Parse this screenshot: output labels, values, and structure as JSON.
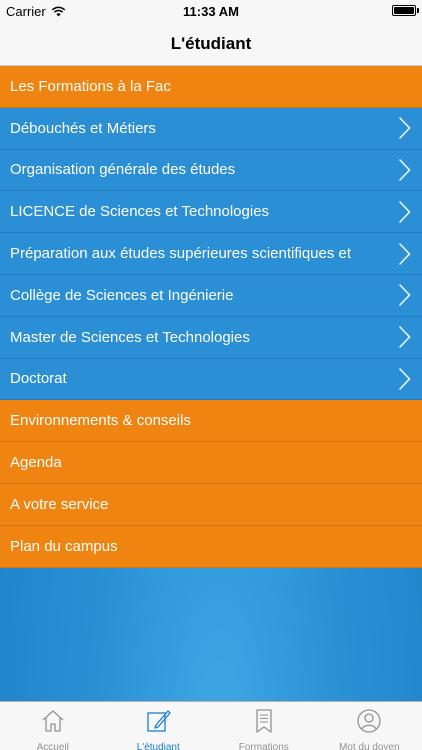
{
  "status_bar": {
    "carrier": "Carrier",
    "time": "11:33 AM"
  },
  "nav": {
    "title": "L'étudiant"
  },
  "menu": [
    {
      "label": "Les Formations à la Fac",
      "kind": "section",
      "chevron": false
    },
    {
      "label": "Débouchés et Métiers",
      "kind": "item",
      "chevron": true
    },
    {
      "label": "Organisation générale des études",
      "kind": "item",
      "chevron": true
    },
    {
      "label": "LICENCE de Sciences et Technologies",
      "kind": "item",
      "chevron": true
    },
    {
      "label": "Préparation aux études supérieures scientifiques et",
      "kind": "item",
      "chevron": true
    },
    {
      "label": "Collège de Sciences et Ingénierie",
      "kind": "item",
      "chevron": true
    },
    {
      "label": "Master de Sciences et Technologies",
      "kind": "item",
      "chevron": true
    },
    {
      "label": "Doctorat",
      "kind": "item",
      "chevron": true
    },
    {
      "label": "Environnements & conseils",
      "kind": "section",
      "chevron": false
    },
    {
      "label": "Agenda",
      "kind": "section",
      "chevron": false
    },
    {
      "label": "A votre service",
      "kind": "section",
      "chevron": false
    },
    {
      "label": "Plan du campus",
      "kind": "section",
      "chevron": false
    }
  ],
  "tabs": [
    {
      "label": "Accueil",
      "icon": "house-icon",
      "active": false
    },
    {
      "label": "L'étudiant",
      "icon": "note-edit-icon",
      "active": true
    },
    {
      "label": "Formations",
      "icon": "bookmark-icon",
      "active": false
    },
    {
      "label": "Mot du doyen",
      "icon": "user-icon",
      "active": false
    }
  ],
  "colors": {
    "section": "#f08410",
    "item": "#2b8fd6",
    "active_tab": "#1a7ed1",
    "inactive_tab": "#929292"
  }
}
